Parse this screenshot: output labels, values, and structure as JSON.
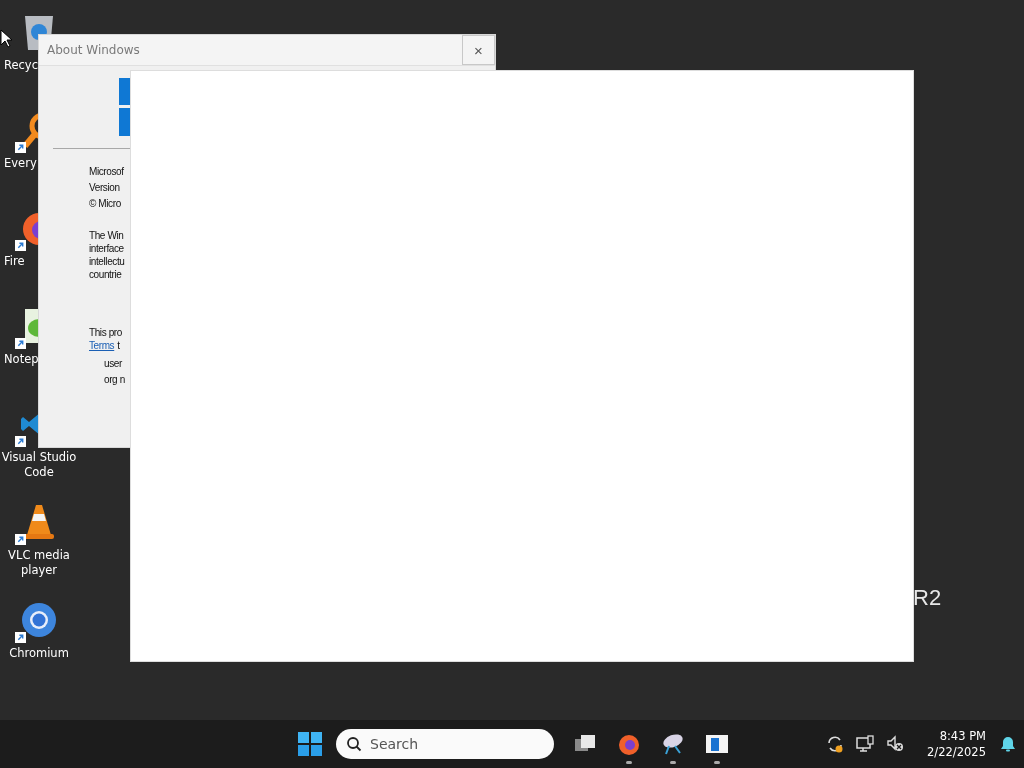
{
  "desktop_icons": [
    {
      "label": "Recyc",
      "kind": "recycle",
      "partial": true
    },
    {
      "label": "Every",
      "kind": "search",
      "partial": true
    },
    {
      "label": "Fire",
      "kind": "firefox",
      "partial": true
    },
    {
      "label": "Notep",
      "kind": "notepad",
      "partial": true
    },
    {
      "label": "Visual Studio Code",
      "kind": "vscode",
      "partial": false
    },
    {
      "label": "VLC media player",
      "kind": "vlc",
      "partial": false
    },
    {
      "label": "Chromium",
      "kind": "chromium",
      "partial": false
    }
  ],
  "dialog": {
    "title": "About Windows",
    "close": "×",
    "info_lines": [
      "Microsof",
      "Version",
      "© Micro"
    ],
    "notice_lines": [
      "The Win",
      "interface",
      "intellectu",
      "countrie"
    ],
    "license_line": "This pro",
    "terms_link": "Terms",
    "terms_rest": "t",
    "licensee_lines": [
      "user",
      "org n"
    ]
  },
  "wallpaper_text": "R2",
  "taskbar": {
    "search": {
      "placeholder": "Search"
    },
    "apps": [
      {
        "kind": "taskview",
        "running": false
      },
      {
        "kind": "firefox",
        "running": true
      },
      {
        "kind": "satellite",
        "running": true
      },
      {
        "kind": "window",
        "running": true
      }
    ],
    "time": "8:43 PM",
    "date": "2/22/2025"
  }
}
